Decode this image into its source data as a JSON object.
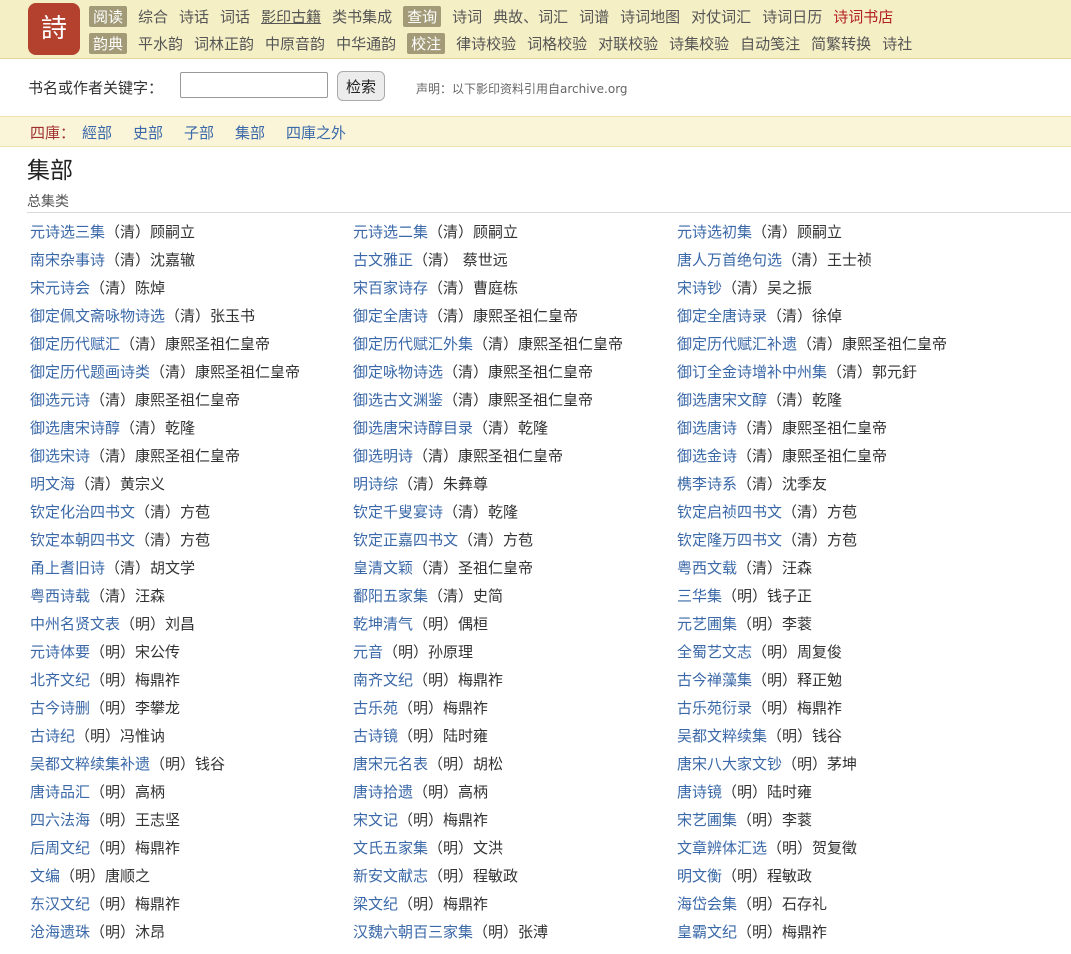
{
  "logo": {
    "text": "詩"
  },
  "nav": {
    "row1": [
      {
        "text": "阅读",
        "style": "grp"
      },
      {
        "text": "综合"
      },
      {
        "text": "诗话"
      },
      {
        "text": "词话"
      },
      {
        "text": "影印古籍",
        "style": "cur"
      },
      {
        "text": "类书集成"
      },
      {
        "text": "查询",
        "style": "grp"
      },
      {
        "text": "诗词"
      },
      {
        "text": "典故、词汇"
      },
      {
        "text": "词谱"
      },
      {
        "text": "诗词地图"
      },
      {
        "text": "对仗词汇"
      },
      {
        "text": "诗词日历"
      },
      {
        "text": "诗词书店",
        "style": "red"
      }
    ],
    "row2": [
      {
        "text": "韵典",
        "style": "grp"
      },
      {
        "text": "平水韵"
      },
      {
        "text": "词林正韵"
      },
      {
        "text": "中原音韵"
      },
      {
        "text": "中华通韵"
      },
      {
        "text": "校注",
        "style": "grp"
      },
      {
        "text": "律诗校验"
      },
      {
        "text": "词格校验"
      },
      {
        "text": "对联校验"
      },
      {
        "text": "诗集校验"
      },
      {
        "text": "自动笺注"
      },
      {
        "text": "简繁转换"
      },
      {
        "text": "诗社"
      }
    ]
  },
  "search": {
    "label": "书名或作者关键字：",
    "value": "",
    "button": "检索",
    "note": "声明：以下影印资料引用自archive.org"
  },
  "siku": {
    "label": "四庫：",
    "links": [
      "經部",
      "史部",
      "子部",
      "集部",
      "四庫之外"
    ]
  },
  "page_title": "集部",
  "subcategory": "总集类",
  "columns": [
    [
      {
        "t": "元诗选三集",
        "a": "（清）顾嗣立"
      },
      {
        "t": "南宋杂事诗",
        "a": "（清）沈嘉辙"
      },
      {
        "t": "宋元诗会",
        "a": "（清）陈焯"
      },
      {
        "t": "御定佩文斋咏物诗选",
        "a": "（清）张玉书"
      },
      {
        "t": "御定历代赋汇",
        "a": "（清）康熙圣祖仁皇帝"
      },
      {
        "t": "御定历代题画诗类",
        "a": "（清）康熙圣祖仁皇帝"
      },
      {
        "t": "御选元诗",
        "a": "（清）康熙圣祖仁皇帝"
      },
      {
        "t": "御选唐宋诗醇",
        "a": "（清）乾隆"
      },
      {
        "t": "御选宋诗",
        "a": "（清）康熙圣祖仁皇帝"
      },
      {
        "t": "明文海",
        "a": "（清）黄宗义"
      },
      {
        "t": "钦定化治四书文",
        "a": "（清）方苞"
      },
      {
        "t": "钦定本朝四书文",
        "a": "（清）方苞"
      },
      {
        "t": "甬上耆旧诗",
        "a": "（清）胡文学"
      },
      {
        "t": "粤西诗载",
        "a": "（清）汪森"
      },
      {
        "t": "中州名贤文表",
        "a": "（明）刘昌"
      },
      {
        "t": "元诗体要",
        "a": "（明）宋公传"
      },
      {
        "t": "北齐文纪",
        "a": "（明）梅鼎祚"
      },
      {
        "t": "古今诗删",
        "a": "（明）李攀龙"
      },
      {
        "t": "古诗纪",
        "a": "（明）冯惟讷"
      },
      {
        "t": "吴都文粹续集补遗",
        "a": "（明）钱谷"
      },
      {
        "t": "唐诗品汇",
        "a": "（明）高柄"
      },
      {
        "t": "四六法海",
        "a": "（明）王志坚"
      },
      {
        "t": "后周文纪",
        "a": "（明）梅鼎祚"
      },
      {
        "t": "文编",
        "a": "（明）唐顺之"
      },
      {
        "t": "东汉文纪",
        "a": "（明）梅鼎祚"
      },
      {
        "t": "沧海遗珠",
        "a": "（明）沐昂"
      }
    ],
    [
      {
        "t": "元诗选二集",
        "a": "（清）顾嗣立"
      },
      {
        "t": "古文雅正",
        "a": "（清） 蔡世远"
      },
      {
        "t": "宋百家诗存",
        "a": "（清）曹庭栋"
      },
      {
        "t": "御定全唐诗",
        "a": "（清）康熙圣祖仁皇帝"
      },
      {
        "t": "御定历代赋汇外集",
        "a": "（清）康熙圣祖仁皇帝"
      },
      {
        "t": "御定咏物诗选",
        "a": "（清）康熙圣祖仁皇帝"
      },
      {
        "t": "御选古文渊鉴",
        "a": "（清）康熙圣祖仁皇帝"
      },
      {
        "t": "御选唐宋诗醇目录",
        "a": "（清）乾隆"
      },
      {
        "t": "御选明诗",
        "a": "（清）康熙圣祖仁皇帝"
      },
      {
        "t": "明诗综",
        "a": "（清）朱彝尊"
      },
      {
        "t": "钦定千叟宴诗",
        "a": "（清）乾隆"
      },
      {
        "t": "钦定正嘉四书文",
        "a": "（清）方苞"
      },
      {
        "t": "皇清文颖",
        "a": "（清）圣祖仁皇帝"
      },
      {
        "t": "鄱阳五家集",
        "a": "（清）史简"
      },
      {
        "t": "乾坤清气",
        "a": "（明）偶桓"
      },
      {
        "t": "元音",
        "a": "（明）孙原理"
      },
      {
        "t": "南齐文纪",
        "a": "（明）梅鼎祚"
      },
      {
        "t": "古乐苑",
        "a": "（明）梅鼎祚"
      },
      {
        "t": "古诗镜",
        "a": "（明）陆时雍"
      },
      {
        "t": "唐宋元名表",
        "a": "（明）胡松"
      },
      {
        "t": "唐诗拾遗",
        "a": "（明）高柄"
      },
      {
        "t": "宋文记",
        "a": "（明）梅鼎祚"
      },
      {
        "t": "文氏五家集",
        "a": "（明）文洪"
      },
      {
        "t": "新安文献志",
        "a": "（明）程敏政"
      },
      {
        "t": "梁文纪",
        "a": "（明）梅鼎祚"
      },
      {
        "t": "汉魏六朝百三家集",
        "a": "（明）张溥"
      }
    ],
    [
      {
        "t": "元诗选初集",
        "a": "（清）顾嗣立"
      },
      {
        "t": "唐人万首绝句选",
        "a": "（清）王士祯"
      },
      {
        "t": "宋诗钞",
        "a": "（清）吴之振"
      },
      {
        "t": "御定全唐诗录",
        "a": "（清）徐倬"
      },
      {
        "t": "御定历代赋汇补遗",
        "a": "（清）康熙圣祖仁皇帝"
      },
      {
        "t": "御订全金诗增补中州集",
        "a": "（清）郭元釪"
      },
      {
        "t": "御选唐宋文醇",
        "a": "（清）乾隆"
      },
      {
        "t": "御选唐诗",
        "a": "（清）康熙圣祖仁皇帝"
      },
      {
        "t": "御选金诗",
        "a": "（清）康熙圣祖仁皇帝"
      },
      {
        "t": "槜李诗系",
        "a": "（清）沈季友"
      },
      {
        "t": "钦定启祯四书文",
        "a": "（清）方苞"
      },
      {
        "t": "钦定隆万四书文",
        "a": "（清）方苞"
      },
      {
        "t": "粤西文载",
        "a": "（清）汪森"
      },
      {
        "t": "三华集",
        "a": "（明）钱子正"
      },
      {
        "t": "元艺圃集",
        "a": "（明）李蓘"
      },
      {
        "t": "全蜀艺文志",
        "a": "（明）周复俊"
      },
      {
        "t": "古今禅藻集",
        "a": "（明）释正勉"
      },
      {
        "t": "古乐苑衍录",
        "a": "（明）梅鼎祚"
      },
      {
        "t": "吴都文粹续集",
        "a": "（明）钱谷"
      },
      {
        "t": "唐宋八大家文钞",
        "a": "（明）茅坤"
      },
      {
        "t": "唐诗镜",
        "a": "（明）陆时雍"
      },
      {
        "t": "宋艺圃集",
        "a": "（明）李蓘"
      },
      {
        "t": "文章辨体汇选",
        "a": "（明）贺复徵"
      },
      {
        "t": "明文衡",
        "a": "（明）程敏政"
      },
      {
        "t": "海岱会集",
        "a": "（明）石存礼"
      },
      {
        "t": "皇霸文纪",
        "a": "（明）梅鼎祚"
      }
    ]
  ]
}
